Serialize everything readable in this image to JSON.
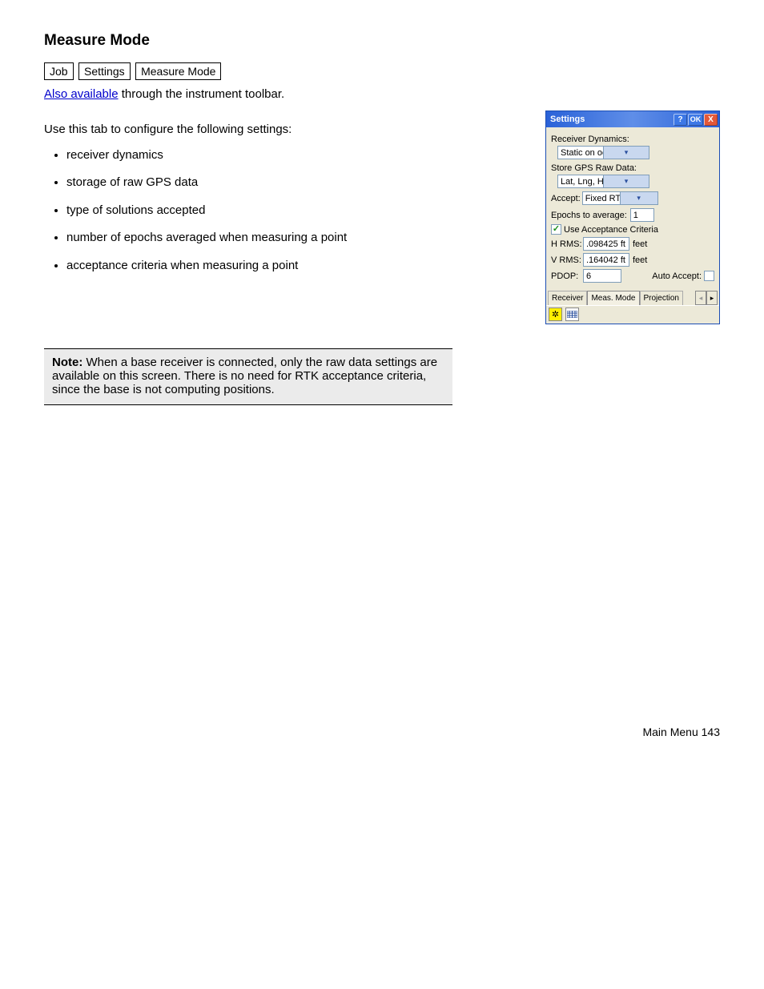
{
  "section_title": "Measure Mode",
  "breadcrumb": [
    "Job",
    "Settings",
    "Measure Mode"
  ],
  "prev_link": "Also available",
  "prev_text": " through the instrument toolbar.",
  "intro": "Use this tab to configure the following settings:",
  "bullets": [
    "receiver dynamics",
    "storage of raw GPS data",
    "type of solutions accepted",
    "number of epochs averaged when measuring a point",
    "acceptance criteria when measuring a point"
  ],
  "dialog": {
    "title": "Settings",
    "btn_help": "?",
    "btn_ok": "OK",
    "btn_close": "X",
    "receiver_dynamics_label": "Receiver Dynamics:",
    "receiver_dynamics_value": "Static on occupy",
    "store_gps_label": "Store GPS Raw Data:",
    "store_gps_value": "Lat, Lng, Ht (EP)",
    "accept_label": "Accept:",
    "accept_value": "Fixed RTK only",
    "epochs_label": "Epochs to average:",
    "epochs_value": "1",
    "use_accept_label": "Use Acceptance Criteria",
    "hrms_label": "H RMS:",
    "hrms_value": ".098425 ft",
    "hrms_unit": "feet",
    "vrms_label": "V RMS:",
    "vrms_value": ".164042 ft",
    "vrms_unit": "feet",
    "pdop_label": "PDOP:",
    "pdop_value": "6",
    "auto_accept_label": "Auto Accept:",
    "tabs": [
      "Receiver",
      "Meas. Mode",
      "Projection"
    ]
  },
  "note": {
    "label": "Note:",
    "text": " When a base receiver is connected, only the raw data settings are available on this screen. There is no need for RTK acceptance criteria, since the base is not computing positions."
  },
  "footer": "Main Menu  143"
}
